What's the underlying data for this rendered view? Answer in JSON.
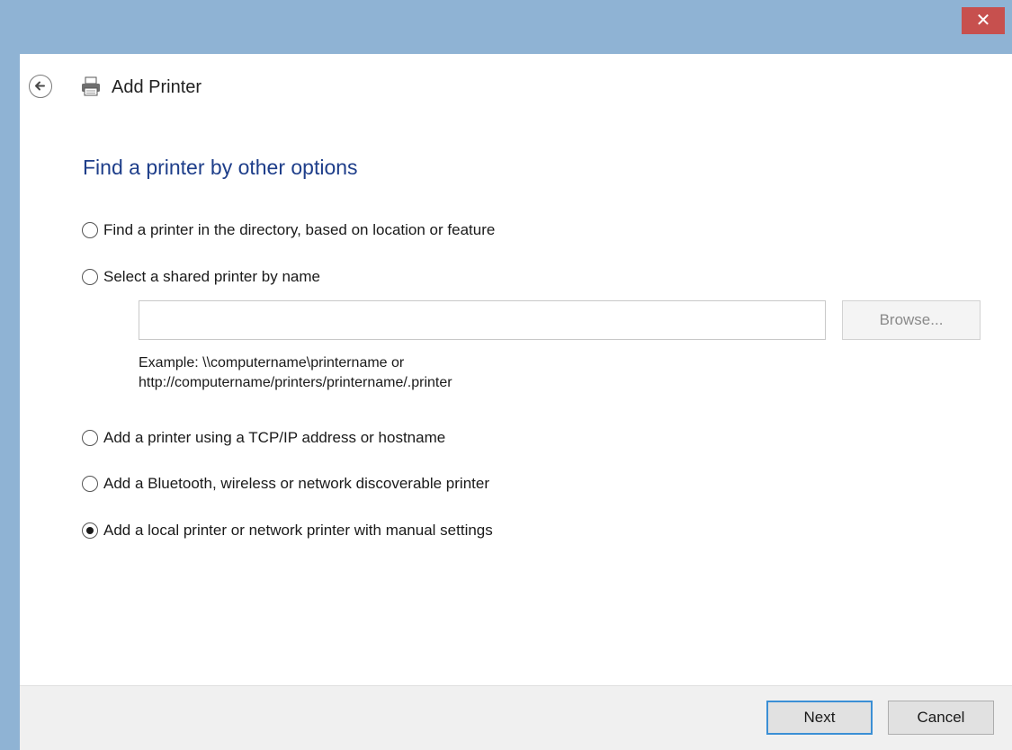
{
  "window": {
    "title": "Add Printer",
    "close_label": "✕"
  },
  "page": {
    "heading": "Find a printer by other options"
  },
  "options": [
    {
      "label": "Find a printer in the directory, based on location or feature",
      "checked": false
    },
    {
      "label": "Select a shared printer by name",
      "checked": false
    },
    {
      "label": "Add a printer using a TCP/IP address or hostname",
      "checked": false
    },
    {
      "label": "Add a Bluetooth, wireless or network discoverable printer",
      "checked": false
    },
    {
      "label": "Add a local printer or network printer with manual settings",
      "checked": true
    }
  ],
  "shared_printer": {
    "value": "",
    "browse_label": "Browse...",
    "example_line1": "Example: \\\\computername\\printername or",
    "example_line2": "http://computername/printers/printername/.printer"
  },
  "footer": {
    "next_label": "Next",
    "cancel_label": "Cancel"
  },
  "colors": {
    "titlebar": "#8fb3d4",
    "close": "#c7504e",
    "heading": "#1e3e8a",
    "default_button_border": "#3b8fd5"
  }
}
